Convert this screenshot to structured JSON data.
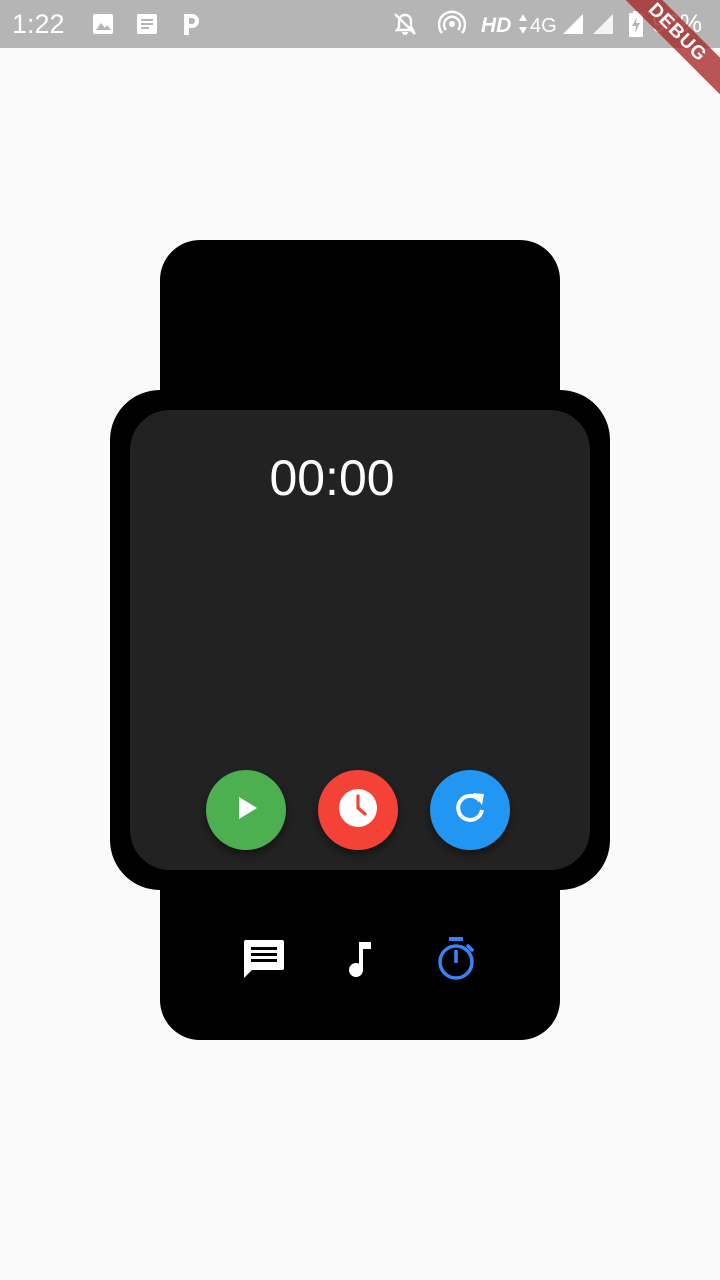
{
  "status_bar": {
    "time": "1:22",
    "hd_label": "HD",
    "network_label": "4G",
    "battery_percent": "96%",
    "icons": [
      "image-icon",
      "document-icon",
      "parking-icon",
      "do-not-disturb-icon",
      "hotspot-icon",
      "data-arrows-icon",
      "signal-icon",
      "signal-icon",
      "battery-charging-icon"
    ]
  },
  "debug_banner": "DEBUG",
  "stopwatch": {
    "time_display": "00:00"
  },
  "controls": [
    {
      "id": "start",
      "icon": "play-icon",
      "color": "#4caf50"
    },
    {
      "id": "lap",
      "icon": "clock-icon",
      "color": "#f44336"
    },
    {
      "id": "reset",
      "icon": "refresh-icon",
      "color": "#2196f3"
    }
  ],
  "bottom_nav": [
    {
      "id": "messages",
      "icon": "message-icon",
      "color": "#ffffff",
      "active": false
    },
    {
      "id": "music",
      "icon": "music-note-icon",
      "color": "#ffffff",
      "active": false
    },
    {
      "id": "stopwatch",
      "icon": "stopwatch-icon",
      "color": "#3b82f6",
      "active": true
    }
  ],
  "colors": {
    "background": "#fafafa",
    "status_bar": "#b5b5b5",
    "watch_frame": "#000000",
    "watch_screen": "#222222",
    "active_nav": "#3b82f6"
  }
}
